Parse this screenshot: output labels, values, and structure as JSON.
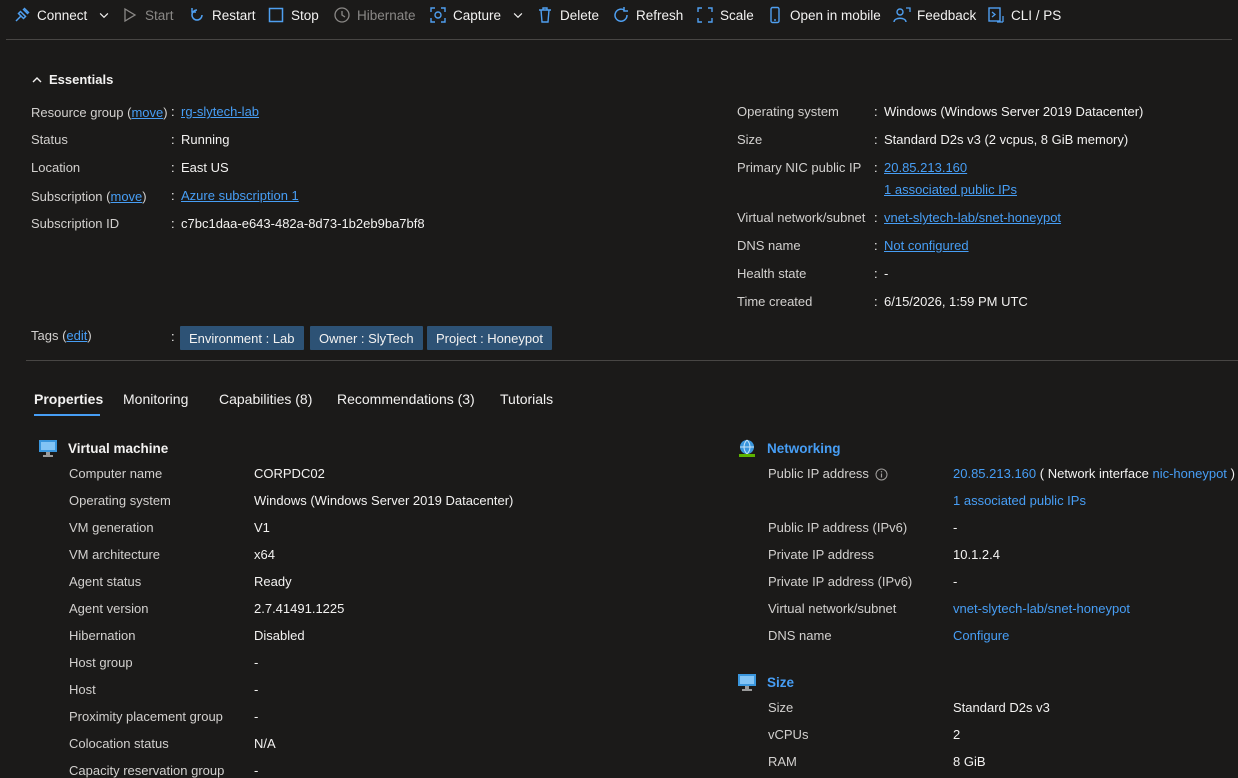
{
  "toolbar": {
    "connect": "Connect",
    "start": "Start",
    "restart": "Restart",
    "stop": "Stop",
    "hibernate": "Hibernate",
    "capture": "Capture",
    "delete": "Delete",
    "refresh": "Refresh",
    "scale": "Scale",
    "open_mobile": "Open in mobile",
    "feedback": "Feedback",
    "cli": "CLI / PS"
  },
  "essentials": {
    "header": "Essentials",
    "colon": ":",
    "move": "move",
    "edit": "edit",
    "left": {
      "resource_group_label": "Resource group",
      "resource_group_value": "rg-slytech-lab",
      "status_label": "Status",
      "status_value": "Running",
      "location_label": "Location",
      "location_value": "East US",
      "subscription_label": "Subscription",
      "subscription_value": "Azure subscription 1",
      "subscription_id_label": "Subscription ID",
      "subscription_id_value": "c7bc1daa-e643-482a-8d73-1b2eb9ba7bf8"
    },
    "right": {
      "os_label": "Operating system",
      "os_value": "Windows (Windows Server 2019 Datacenter)",
      "size_label": "Size",
      "size_value": "Standard D2s v3 (2 vcpus, 8 GiB memory)",
      "nic_ip_label": "Primary NIC public IP",
      "nic_ip_value": "20.85.213.160",
      "nic_ip_assoc": "1 associated public IPs",
      "vnet_label": "Virtual network/subnet",
      "vnet_value": "vnet-slytech-lab/snet-honeypot",
      "dns_label": "DNS name",
      "dns_value": "Not configured",
      "health_label": "Health state",
      "health_value": "-",
      "time_label": "Time created",
      "time_value": "6/15/2026, 1:59 PM UTC"
    },
    "tags_label": "Tags",
    "tags": [
      "Environment : Lab",
      "Owner : SlyTech",
      "Project : Honeypot"
    ]
  },
  "tabs": [
    "Properties",
    "Monitoring",
    "Capabilities (8)",
    "Recommendations (3)",
    "Tutorials"
  ],
  "vm": {
    "title": "Virtual machine",
    "rows": [
      {
        "label": "Computer name",
        "value": "CORPDC02"
      },
      {
        "label": "Operating system",
        "value": "Windows (Windows Server 2019 Datacenter)"
      },
      {
        "label": "VM generation",
        "value": "V1"
      },
      {
        "label": "VM architecture",
        "value": "x64"
      },
      {
        "label": "Agent status",
        "value": "Ready"
      },
      {
        "label": "Agent version",
        "value": "2.7.41491.1225"
      },
      {
        "label": "Hibernation",
        "value": "Disabled"
      },
      {
        "label": "Host group",
        "value": "-"
      },
      {
        "label": "Host",
        "value": "-"
      },
      {
        "label": "Proximity placement group",
        "value": "-"
      },
      {
        "label": "Colocation status",
        "value": "N/A"
      },
      {
        "label": "Capacity reservation group",
        "value": "-"
      }
    ]
  },
  "networking": {
    "title": "Networking",
    "public_ip_label": "Public IP address",
    "public_ip_value": "20.85.213.160",
    "nic_prefix": "( Network interface",
    "nic_name": "nic-honeypot",
    "nic_suffix": ")",
    "assoc_ips": "1 associated public IPs",
    "ipv6_label": "Public IP address (IPv6)",
    "ipv6_value": "-",
    "private_ip_label": "Private IP address",
    "private_ip_value": "10.1.2.4",
    "private_ipv6_label": "Private IP address (IPv6)",
    "private_ipv6_value": "-",
    "vnet_label": "Virtual network/subnet",
    "vnet_value": "vnet-slytech-lab/snet-honeypot",
    "dns_label": "DNS name",
    "dns_value": "Configure"
  },
  "size": {
    "title": "Size",
    "size_label": "Size",
    "size_value": "Standard D2s v3",
    "vcpus_label": "vCPUs",
    "vcpus_value": "2",
    "ram_label": "RAM",
    "ram_value": "8 GiB"
  },
  "colors": {
    "background": "#1b1a19",
    "link": "#479ef5",
    "tag_bg": "#2d5275",
    "divider": "#484644"
  },
  "icons": [
    "connect-icon",
    "start-icon",
    "restart-icon",
    "stop-icon",
    "hibernate-icon",
    "capture-icon",
    "delete-icon",
    "refresh-icon",
    "scale-icon",
    "mobile-icon",
    "feedback-icon",
    "cli-icon",
    "monitor-icon",
    "globe-icon",
    "info-icon",
    "chevron-up-icon",
    "chevron-down-icon"
  ]
}
